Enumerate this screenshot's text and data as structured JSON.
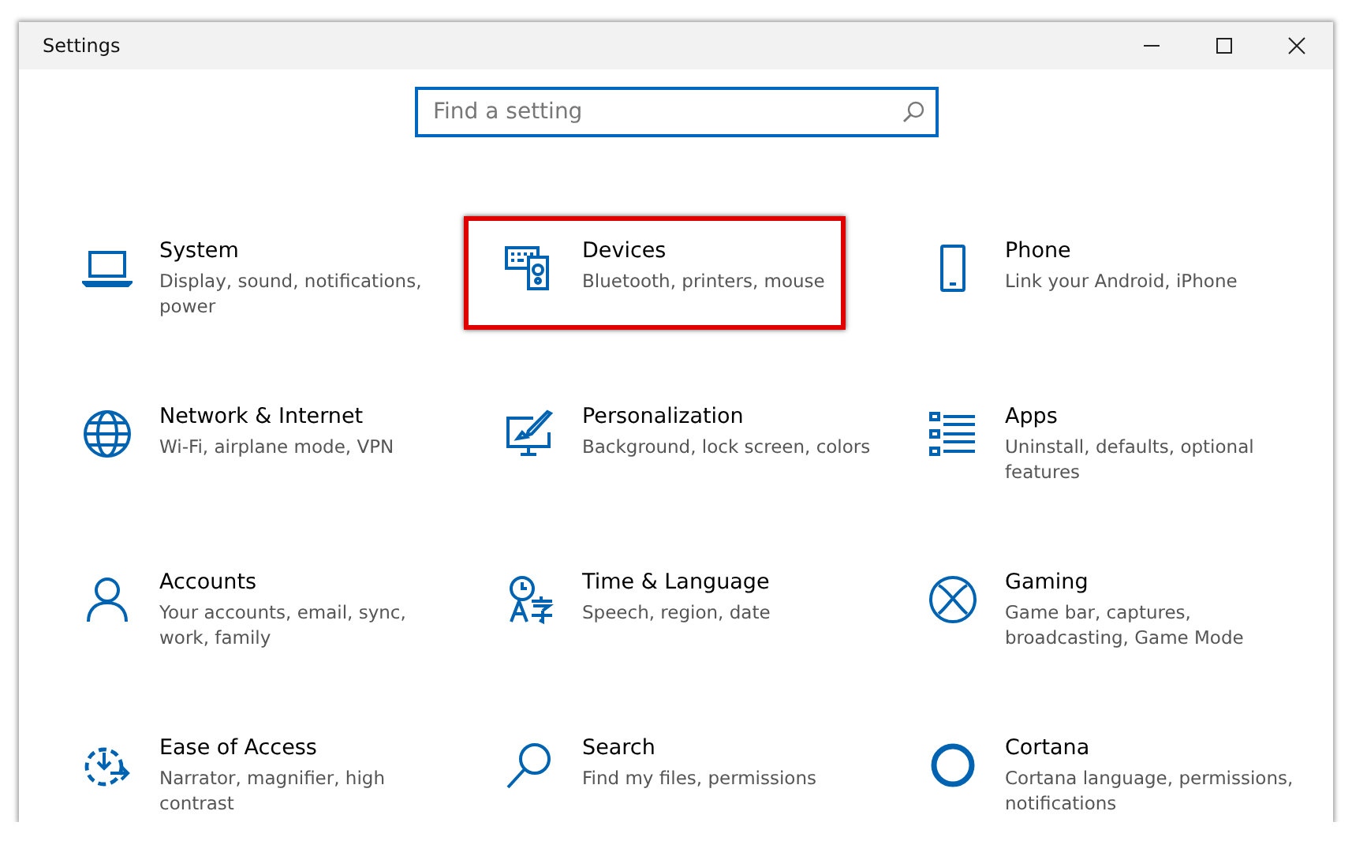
{
  "window": {
    "title": "Settings"
  },
  "search": {
    "placeholder": "Find a setting"
  },
  "tiles": [
    {
      "kind": "system",
      "title": "System",
      "description": "Display, sound, notifications, power",
      "highlighted": false
    },
    {
      "kind": "devices",
      "title": "Devices",
      "description": "Bluetooth, printers, mouse",
      "highlighted": true
    },
    {
      "kind": "phone",
      "title": "Phone",
      "description": "Link your Android, iPhone",
      "highlighted": false
    },
    {
      "kind": "network",
      "title": "Network & Internet",
      "description": "Wi-Fi, airplane mode, VPN",
      "highlighted": false
    },
    {
      "kind": "personalization",
      "title": "Personalization",
      "description": "Background, lock screen, colors",
      "highlighted": false
    },
    {
      "kind": "apps",
      "title": "Apps",
      "description": "Uninstall, defaults, optional features",
      "highlighted": false
    },
    {
      "kind": "accounts",
      "title": "Accounts",
      "description": "Your accounts, email, sync, work, family",
      "highlighted": false
    },
    {
      "kind": "time",
      "title": "Time & Language",
      "description": "Speech, region, date",
      "highlighted": false
    },
    {
      "kind": "gaming",
      "title": "Gaming",
      "description": "Game bar, captures, broadcasting, Game Mode",
      "highlighted": false
    },
    {
      "kind": "ease",
      "title": "Ease of Access",
      "description": "Narrator, magnifier, high contrast",
      "highlighted": false
    },
    {
      "kind": "search",
      "title": "Search",
      "description": "Find my files, permissions",
      "highlighted": false
    },
    {
      "kind": "cortana",
      "title": "Cortana",
      "description": "Cortana language, permissions, notifications",
      "highlighted": false
    }
  ]
}
